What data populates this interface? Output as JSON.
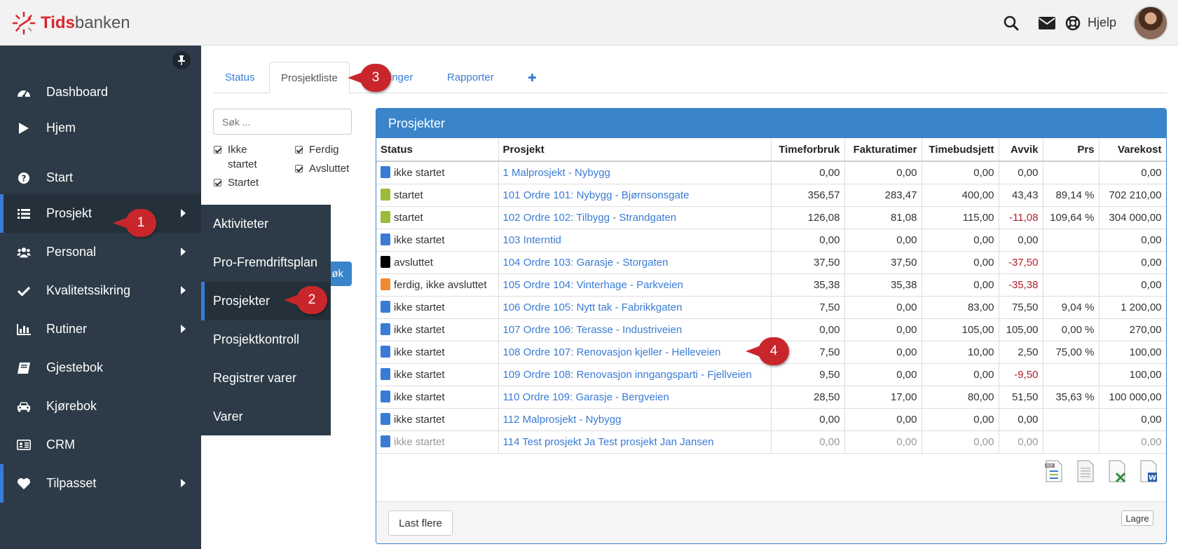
{
  "brand": {
    "name_part1": "Tids",
    "name_part2": "banken"
  },
  "header": {
    "help_label": "Hjelp"
  },
  "sidebar": {
    "items": [
      {
        "label": "Dashboard",
        "icon": "dashboard-icon"
      },
      {
        "label": "Hjem",
        "icon": "play-icon"
      },
      {
        "label": "Start",
        "icon": "question-icon"
      },
      {
        "label": "Prosjekt",
        "icon": "list-icon"
      },
      {
        "label": "Personal",
        "icon": "users-icon"
      },
      {
        "label": "Kvalitetssikring",
        "icon": "check-icon"
      },
      {
        "label": "Rutiner",
        "icon": "bar-chart-icon"
      },
      {
        "label": "Gjestebok",
        "icon": "book-icon"
      },
      {
        "label": "Kjørebok",
        "icon": "car-icon"
      },
      {
        "label": "CRM",
        "icon": "id-card-icon"
      },
      {
        "label": "Tilpasset",
        "icon": "heart-icon"
      }
    ]
  },
  "submenu": {
    "items": [
      "Aktiviteter",
      "Pro-Fremdriftsplan",
      "Prosjekter",
      "Prosjektkontroll",
      "Registrer varer",
      "Varer"
    ]
  },
  "callouts": [
    "1",
    "2",
    "3",
    "4"
  ],
  "tabs": [
    "Status",
    "Prosjektliste",
    "illinger",
    "Rapporter",
    "✚"
  ],
  "filter": {
    "search_placeholder": "Søk ...",
    "cb_ikke_startet": "Ikke startet",
    "cb_startet": "Startet",
    "cb_ferdig": "Ferdig",
    "cb_avsluttet": "Avsluttet",
    "search_button": "øk"
  },
  "panel": {
    "title": "Prosjekter",
    "columns": [
      "Status",
      "Prosjekt",
      "Timeforbruk",
      "Fakturatimer",
      "Timebudsjett",
      "Avvik",
      "Prs",
      "Varekost"
    ],
    "rows": [
      {
        "color": "#3a7bd5",
        "status": "ikke startet",
        "project": "1 Malprosjekt - Nybygg",
        "timeforbruk": "0,00",
        "fakturatimer": "0,00",
        "timebudsjett": "0,00",
        "avvik": "0,00",
        "prs": "",
        "varekost": "0,00"
      },
      {
        "color": "#9bbb3b",
        "status": "startet",
        "project": "101 Ordre 101: Nybygg - Bjørnsonsgate",
        "timeforbruk": "356,57",
        "fakturatimer": "283,47",
        "timebudsjett": "400,00",
        "avvik": "43,43",
        "prs": "89,14 %",
        "varekost": "702 210,00"
      },
      {
        "color": "#9bbb3b",
        "status": "startet",
        "project": "102 Ordre 102: Tilbygg - Strandgaten",
        "timeforbruk": "126,08",
        "fakturatimer": "81,08",
        "timebudsjett": "115,00",
        "avvik": "-11,08",
        "prs": "109,64 %",
        "varekost": "304 000,00"
      },
      {
        "color": "#3a7bd5",
        "status": "ikke startet",
        "project": "103 Interntid",
        "timeforbruk": "0,00",
        "fakturatimer": "0,00",
        "timebudsjett": "0,00",
        "avvik": "0,00",
        "prs": "",
        "varekost": "0,00"
      },
      {
        "color": "#000000",
        "status": "avsluttet",
        "project": "104 Ordre 103: Garasje - Storgaten",
        "timeforbruk": "37,50",
        "fakturatimer": "37,50",
        "timebudsjett": "0,00",
        "avvik": "-37,50",
        "prs": "",
        "varekost": "0,00"
      },
      {
        "color": "#f08a33",
        "status": "ferdig, ikke avsluttet",
        "project": "105 Ordre 104: Vinterhage - Parkveien",
        "timeforbruk": "35,38",
        "fakturatimer": "35,38",
        "timebudsjett": "0,00",
        "avvik": "-35,38",
        "prs": "",
        "varekost": "0,00"
      },
      {
        "color": "#3a7bd5",
        "status": "ikke startet",
        "project": "106 Ordre 105: Nytt tak - Fabrikkgaten",
        "timeforbruk": "7,50",
        "fakturatimer": "0,00",
        "timebudsjett": "83,00",
        "avvik": "75,50",
        "prs": "9,04 %",
        "varekost": "1 200,00"
      },
      {
        "color": "#3a7bd5",
        "status": "ikke startet",
        "project": "107 Ordre 106: Terasse - Industriveien",
        "timeforbruk": "0,00",
        "fakturatimer": "0,00",
        "timebudsjett": "105,00",
        "avvik": "105,00",
        "prs": "0,00 %",
        "varekost": "270,00"
      },
      {
        "color": "#3a7bd5",
        "status": "ikke startet",
        "project": "108 Ordre 107: Renovasjon kjeller - Helleveien",
        "timeforbruk": "7,50",
        "fakturatimer": "0,00",
        "timebudsjett": "10,00",
        "avvik": "2,50",
        "prs": "75,00 %",
        "varekost": "100,00"
      },
      {
        "color": "#3a7bd5",
        "status": "ikke startet",
        "project": "109 Ordre 108: Renovasjon inngangsparti - Fjellveien",
        "timeforbruk": "9,50",
        "fakturatimer": "0,00",
        "timebudsjett": "0,00",
        "avvik": "-9,50",
        "prs": "",
        "varekost": "100,00"
      },
      {
        "color": "#3a7bd5",
        "status": "ikke startet",
        "project": "110 Ordre 109: Garasje - Bergveien",
        "timeforbruk": "28,50",
        "fakturatimer": "17,00",
        "timebudsjett": "80,00",
        "avvik": "51,50",
        "prs": "35,63 %",
        "varekost": "100 000,00"
      },
      {
        "color": "#3a7bd5",
        "status": "ikke startet",
        "project": "112 Malprosjekt - Nybygg",
        "timeforbruk": "0,00",
        "fakturatimer": "0,00",
        "timebudsjett": "0,00",
        "avvik": "0,00",
        "prs": "",
        "varekost": "0,00"
      },
      {
        "color": "#3a7bd5",
        "status": "ikke startet",
        "project": "114 Test prosjekt Ja Test prosjekt Jan Jansen",
        "timeforbruk": "0,00",
        "fakturatimer": "0,00",
        "timebudsjett": "0,00",
        "avvik": "0,00",
        "prs": "",
        "varekost": "0,00"
      }
    ],
    "export_icons": [
      "pdf-export-icon",
      "print-icon",
      "excel-export-icon",
      "word-export-icon"
    ],
    "load_more": "Last flere",
    "save": "Lagre"
  }
}
